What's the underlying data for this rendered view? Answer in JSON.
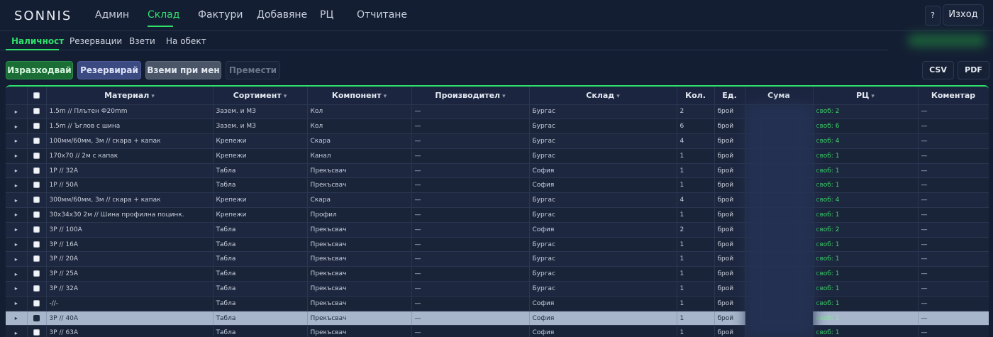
{
  "brand": {
    "logo": "SONNIS"
  },
  "nav": {
    "items": [
      {
        "label": "Админ"
      },
      {
        "label": "Склад"
      },
      {
        "label": "Фактури"
      },
      {
        "label": "Добавяне"
      },
      {
        "label": "РЦ"
      },
      {
        "label": "Отчитане"
      }
    ],
    "active": "Склад",
    "help_label": "?",
    "logout_label": "Изход"
  },
  "subnav": {
    "items": [
      {
        "label": "Наличност"
      },
      {
        "label": "Резервации"
      },
      {
        "label": "Взети"
      },
      {
        "label": "На обект"
      }
    ],
    "active": "Наличност"
  },
  "actions": {
    "consume": "Изразходвай",
    "reserve": "Резервирай",
    "take": "Вземи при мен",
    "move": "Премести",
    "csv": "CSV",
    "pdf": "PDF"
  },
  "colors": {
    "accent": "#2fe06a",
    "consume": "#1a6e35",
    "reserve": "#3c4a82",
    "take": "#4a5668",
    "selected_row": "#a7b6cb"
  },
  "table": {
    "columns": {
      "material": "Материал",
      "sortiment": "Сортимент",
      "component": "Компонент",
      "producer": "Производител",
      "warehouse": "Склад",
      "qty": "Кол.",
      "unit": "Ед.",
      "sum": "Сума",
      "rc": "РЦ",
      "comment": "Коментар"
    },
    "filter_icon": "▾",
    "expand_icon": "▸",
    "rows": [
      {
        "material": "1.5m // Плътен Ф20mm",
        "sortiment": "Зазем. и МЗ",
        "component": "Кол",
        "producer": "—",
        "warehouse": "Бургас",
        "qty": "2",
        "unit": "брой",
        "rc": "своб: 2",
        "comment": "—"
      },
      {
        "material": "1.5m // Ъглов с шина",
        "sortiment": "Зазем. и МЗ",
        "component": "Кол",
        "producer": "—",
        "warehouse": "Бургас",
        "qty": "6",
        "unit": "брой",
        "rc": "своб: 6",
        "comment": "—"
      },
      {
        "material": "100мм/60мм, 3м // скара + капак",
        "sortiment": "Крепежи",
        "component": "Скара",
        "producer": "—",
        "warehouse": "Бургас",
        "qty": "4",
        "unit": "брой",
        "rc": "своб: 4",
        "comment": "—"
      },
      {
        "material": "170x70 // 2м с капак",
        "sortiment": "Крепежи",
        "component": "Канал",
        "producer": "—",
        "warehouse": "Бургас",
        "qty": "1",
        "unit": "брой",
        "rc": "своб: 1",
        "comment": "—"
      },
      {
        "material": "1P // 32A",
        "sortiment": "Табла",
        "component": "Прекъсвач",
        "producer": "—",
        "warehouse": "София",
        "qty": "1",
        "unit": "брой",
        "rc": "своб: 1",
        "comment": "—"
      },
      {
        "material": "1P // 50A",
        "sortiment": "Табла",
        "component": "Прекъсвач",
        "producer": "—",
        "warehouse": "София",
        "qty": "1",
        "unit": "брой",
        "rc": "своб: 1",
        "comment": "—"
      },
      {
        "material": "300мм/60мм, 3м // скара + капак",
        "sortiment": "Крепежи",
        "component": "Скара",
        "producer": "—",
        "warehouse": "Бургас",
        "qty": "4",
        "unit": "брой",
        "rc": "своб: 4",
        "comment": "—"
      },
      {
        "material": "30x34x30 2м // Шина профилна поцинк.",
        "sortiment": "Крепежи",
        "component": "Профил",
        "producer": "—",
        "warehouse": "Бургас",
        "qty": "1",
        "unit": "брой",
        "rc": "своб: 1",
        "comment": "—"
      },
      {
        "material": "3P // 100A",
        "sortiment": "Табла",
        "component": "Прекъсвач",
        "producer": "—",
        "warehouse": "София",
        "qty": "2",
        "unit": "брой",
        "rc": "своб: 2",
        "comment": "—"
      },
      {
        "material": "3P // 16A",
        "sortiment": "Табла",
        "component": "Прекъсвач",
        "producer": "—",
        "warehouse": "Бургас",
        "qty": "1",
        "unit": "брой",
        "rc": "своб: 1",
        "comment": "—"
      },
      {
        "material": "3P // 20A",
        "sortiment": "Табла",
        "component": "Прекъсвач",
        "producer": "—",
        "warehouse": "Бургас",
        "qty": "1",
        "unit": "брой",
        "rc": "своб: 1",
        "comment": "—"
      },
      {
        "material": "3P // 25A",
        "sortiment": "Табла",
        "component": "Прекъсвач",
        "producer": "—",
        "warehouse": "Бургас",
        "qty": "1",
        "unit": "брой",
        "rc": "своб: 1",
        "comment": "—"
      },
      {
        "material": "3P // 32A",
        "sortiment": "Табла",
        "component": "Прекъсвач",
        "producer": "—",
        "warehouse": "Бургас",
        "qty": "1",
        "unit": "брой",
        "rc": "своб: 1",
        "comment": "—"
      },
      {
        "material": "-//-",
        "sortiment": "Табла",
        "component": "Прекъсвач",
        "producer": "—",
        "warehouse": "София",
        "qty": "1",
        "unit": "брой",
        "rc": "своб: 1",
        "comment": "—"
      },
      {
        "material": "3P // 40A",
        "sortiment": "Табла",
        "component": "Прекъсвач",
        "producer": "—",
        "warehouse": "София",
        "qty": "1",
        "unit": "брой",
        "rc": "своб: 1",
        "comment": "—",
        "selected": true
      },
      {
        "material": "3P // 63A",
        "sortiment": "Табла",
        "component": "Прекъсвач",
        "producer": "—",
        "warehouse": "София",
        "qty": "1",
        "unit": "брой",
        "rc": "своб: 1",
        "comment": "—"
      }
    ]
  }
}
